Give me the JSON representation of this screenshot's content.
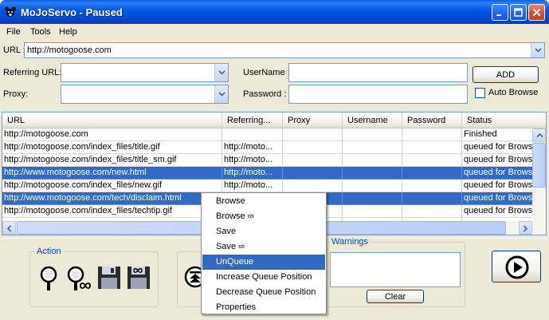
{
  "window": {
    "title": "MoJoServo - Paused"
  },
  "menu": [
    "File",
    "Tools",
    "Help"
  ],
  "form": {
    "url_label": "URL :",
    "url_value": "http://motogoose.com",
    "referring_label": "Referring URL:",
    "proxy_label": "Proxy:",
    "username_label": "UserName :",
    "password_label": "Password :",
    "add_label": "ADD",
    "auto_browse_label": "Auto Browse"
  },
  "table": {
    "headers": [
      "URL",
      "Referring...",
      "Proxy",
      "Username",
      "Password",
      "Status"
    ],
    "rows": [
      {
        "url": "http://motogoose.com",
        "ref": "",
        "status": "Finished",
        "selected": false
      },
      {
        "url": "http://motogoose.com/index_files/title.gif",
        "ref": "http://moto...",
        "status": "queued for Brows...",
        "selected": false
      },
      {
        "url": "http://motogoose.com/index_files/title_sm.gif",
        "ref": "http://moto...",
        "status": "queued for Brows...",
        "selected": false
      },
      {
        "url": "http://www.motogoose.com/new.html",
        "ref": "http://moto...",
        "status": "queued for Brows...",
        "selected": true
      },
      {
        "url": "http://motogoose.com/index_files/new.gif",
        "ref": "http://moto...",
        "status": "queued for Brows...",
        "selected": false
      },
      {
        "url": "http://www.motogoose.com/tech/disclaim.html",
        "ref": "",
        "status": "queued for Brows...",
        "selected": true
      },
      {
        "url": "http://motogoose.com/index_files/techtip.gif",
        "ref": "",
        "status": "queued for Brows...",
        "selected": false
      },
      {
        "url": "",
        "ref": "",
        "status": "",
        "selected": false
      }
    ]
  },
  "action_panel": {
    "legend": "Action"
  },
  "warnings_panel": {
    "legend": "Warnings",
    "clear_label": "Clear"
  },
  "context_menu": {
    "items": [
      "Browse",
      "Browse ∞",
      "Save",
      "Save ∞",
      "UnQueue",
      "Increase Queue Position",
      "Decrease Queue Position",
      "Properties"
    ],
    "highlighted": 4
  }
}
